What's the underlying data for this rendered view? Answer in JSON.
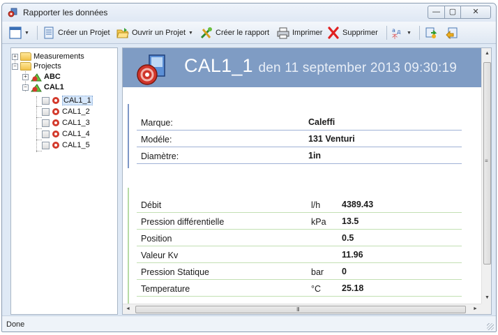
{
  "window": {
    "title": "Rapporter les données",
    "controls": {
      "minimize": "—",
      "maximize": "▢",
      "close": "✕"
    }
  },
  "toolbar": {
    "view_icon": "panel-icon",
    "create_project": "Créer un Projet",
    "open_project": "Ouvrir un Projet",
    "create_report": "Créer le rapport",
    "print": "Imprimer",
    "delete": "Supprimer",
    "language_icon": "language-icon",
    "export_icon": "export-icon",
    "import_icon": "import-icon"
  },
  "tree": {
    "measurements": "Measurements",
    "projects": "Projects",
    "abc": "ABC",
    "cal1": "CAL1",
    "children": [
      "CAL1_1",
      "CAL1_2",
      "CAL1_3",
      "CAL1_4",
      "CAL1_5"
    ],
    "selected": "CAL1_1"
  },
  "report": {
    "title": "CAL1_1",
    "date": "den 11 september 2013 09:30:19",
    "info": [
      {
        "label": "Marque:",
        "value": "Caleffi"
      },
      {
        "label": "Modéle:",
        "value": "131 Venturi"
      },
      {
        "label": "Diamètre:",
        "value": "1in"
      }
    ],
    "measurements": [
      {
        "label": "Débit",
        "unit": "l/h",
        "value": "4389.43"
      },
      {
        "label": "Pression différentielle",
        "unit": "kPa",
        "value": "13.5"
      },
      {
        "label": "Position",
        "unit": "",
        "value": "0.5"
      },
      {
        "label": "Valeur Kv",
        "unit": "",
        "value": "11.96"
      },
      {
        "label": "Pression Statique",
        "unit": "bar",
        "value": "0"
      },
      {
        "label": "Temperature",
        "unit": "°C",
        "value": "25.18"
      }
    ]
  },
  "scroll": {
    "h_grip": "III",
    "v_grip": "≡"
  },
  "status": "Done",
  "colors": {
    "banner": "#7f9cc4",
    "info_line": "#9fb2d6",
    "measure_line": "#c2e0b2"
  }
}
